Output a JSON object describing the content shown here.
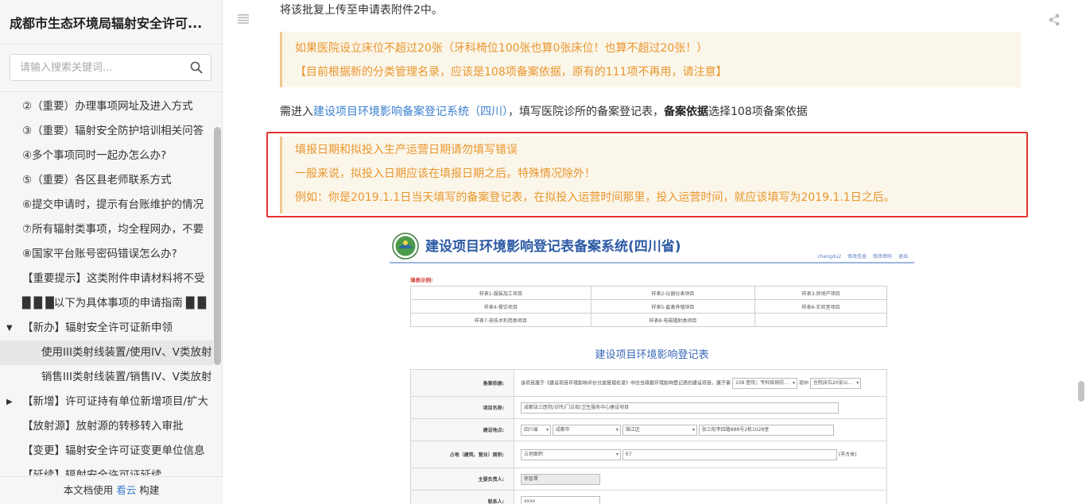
{
  "sidebar": {
    "title": "成都市生态环境局辐射安全许可...",
    "search_placeholder": "请输入搜索关键词...",
    "items": [
      {
        "label": "②（重要）办理事项网址及进入方式",
        "level": 1
      },
      {
        "label": "③（重要）辐射安全防护培训相关问答",
        "level": 1
      },
      {
        "label": "④多个事项同时一起办怎么办?",
        "level": 1
      },
      {
        "label": "⑤（重要）各区县老师联系方式",
        "level": 1
      },
      {
        "label": "⑥提交申请时，提示有台账维护的情况",
        "level": 1
      },
      {
        "label": "⑦所有辐射类事项，均全程网办，不要",
        "level": 1
      },
      {
        "label": "⑧国家平台账号密码错误怎么办?",
        "level": 1
      },
      {
        "label": "【重要提示】这类附件申请材料将不受",
        "level": 1
      },
      {
        "label": "█ █ █以下为具体事项的申请指南 █ █",
        "level": 1
      },
      {
        "label": "【新办】辐射安全许可证新申领",
        "level": 1,
        "arrow": "▼"
      },
      {
        "label": "使用III类射线装置/使用IV、V类放射",
        "level": 2,
        "active": true
      },
      {
        "label": "销售III类射线装置/销售IV、V类放射",
        "level": 2
      },
      {
        "label": "【新增】许可证持有单位新增项目/扩大",
        "level": 1,
        "arrow": "▶"
      },
      {
        "label": "【放射源】放射源的转移转入审批",
        "level": 1
      },
      {
        "label": "【变更】辐射安全许可证变更单位信息",
        "level": 1
      },
      {
        "label": "【延续】辐射安全许可证延续",
        "level": 1
      }
    ],
    "footer_text": "本文档使用",
    "footer_link": "看云",
    "footer_suffix": "构建"
  },
  "content": {
    "top_text": "将该批复上传至申请表附件2中。",
    "note1": [
      "如果医院设立床位不超过20张（牙科椅位100张也算0张床位！也算不超过20张！）",
      "【目前根据新的分类管理名录，应该是108项备案依据，原有的111项不再用，请注意】"
    ],
    "mid_prefix": "需进入",
    "mid_link": "建设项目环境影响备案登记系统（四川）",
    "mid_after_link": "，填写医院诊所的备案登记表，",
    "mid_bold": "备案依据",
    "mid_suffix": "选择108项备案依据",
    "note2": [
      "填报日期和拟投入生产运营日期请勿填写错误",
      "一般来说，拟投入日期应该在填报日期之后。特殊情况除外！",
      "例如：你是2019.1.1日当天填写的备案登记表，在拟投入运营时间那里，投入运营时间，就应该填写为2019.1.1日之后。"
    ]
  },
  "screenshot": {
    "title": "建设项目环境影响登记表备案系统(四川省)",
    "header_links": [
      "chengdu2",
      "修改信息",
      "修改密码",
      "退出"
    ],
    "sample_label": "填表示例:",
    "sample_rows": [
      [
        "样表1-服装加工项目",
        "样表2-仪器仪表项目",
        "样表3-房地产项目"
      ],
      [
        "样表4-餐饮项目",
        "样表5-畜禽养殖项目",
        "样表6-实验室项目"
      ],
      [
        "样表7-核技术利用类项目",
        "样表8-电磁辐射类项目",
        ""
      ]
    ],
    "form_heading": "建设项目环境影响登记表",
    "form": {
      "basis_label": "备案依据:",
      "basis_text": "该项目属于《建设项目环境影响评价分类管理名录》中应当填报环境影响登记表的建设项目，属于第",
      "basis_select": "108 医院；专科疾病防...",
      "basis_mid": "项中",
      "basis_select2": "住院床位20张以...",
      "name_label": "项目名称:",
      "name_value": "成都张三医院/诊所/门诊部/卫生服务中心建设项目",
      "location_label": "建设地点:",
      "province": "四川省",
      "city": "成都市",
      "district": "锦江区",
      "address": "张三街李四路888号2栋1028室",
      "area_label": "占地（建筑、营业）面积:",
      "area_type": "占地面积",
      "area_value": "67",
      "area_unit": "(平方米)",
      "leader_label": "主要负责人:",
      "leader_value": "徐智晋",
      "contact_label": "联系人:",
      "contact_value": "xxxx"
    }
  }
}
